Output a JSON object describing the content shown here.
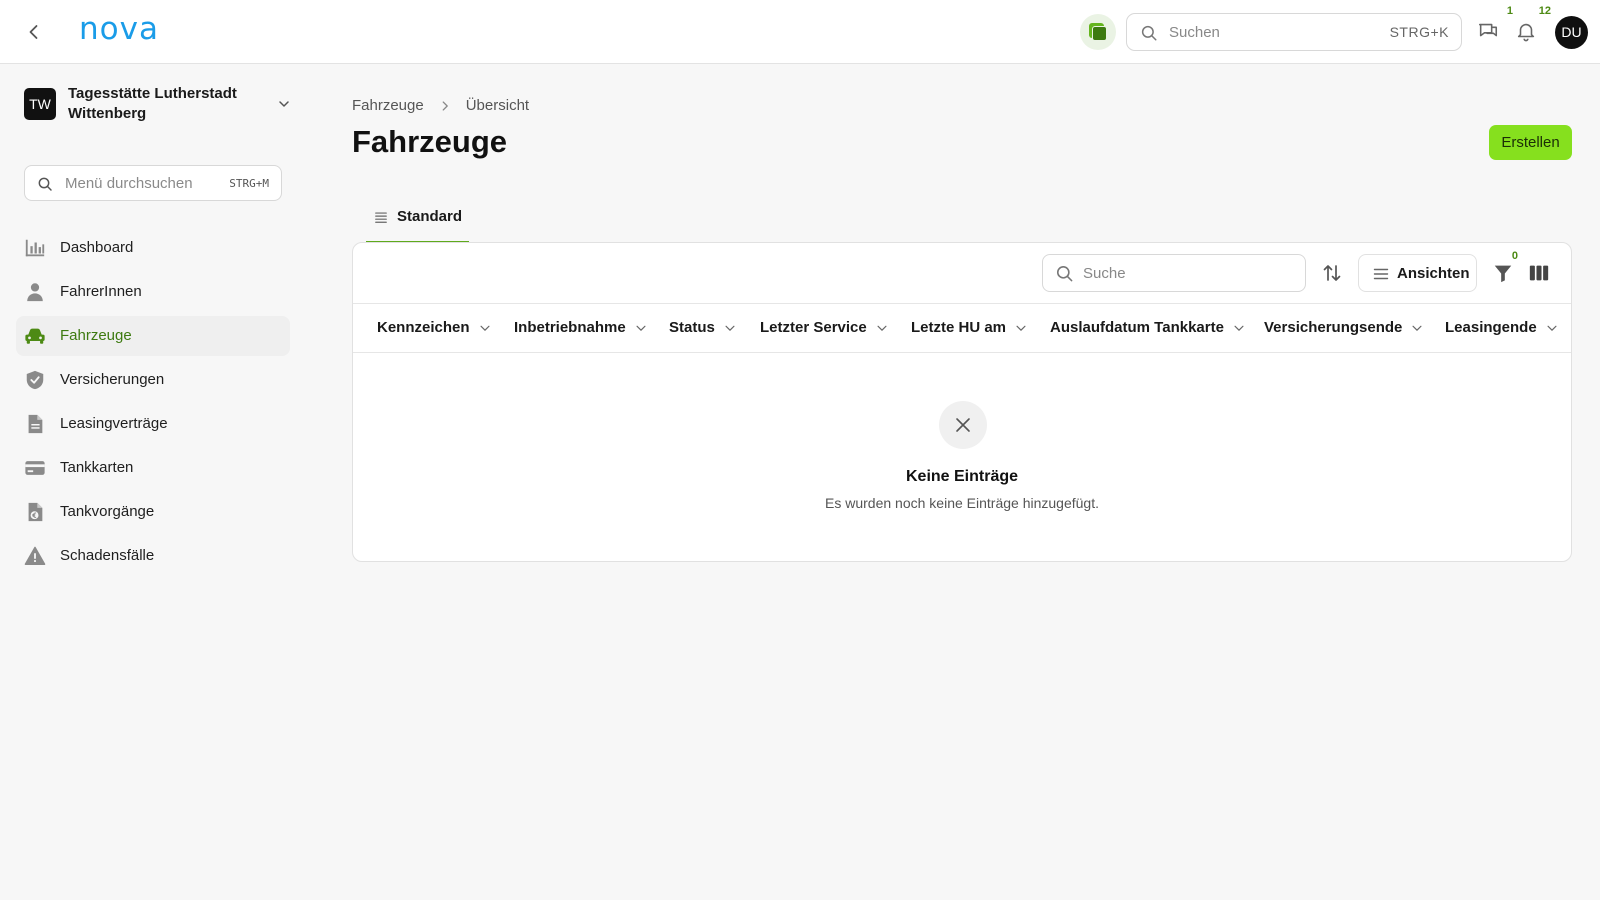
{
  "topbar": {
    "logo": "nova",
    "search_placeholder": "Suchen",
    "search_shortcut": "STRG+K",
    "messages_badge": "1",
    "notifications_badge": "12",
    "avatar_initials": "DU"
  },
  "sidebar": {
    "org_initials": "TW",
    "org_name": "Tagesstätte Lutherstadt Wittenberg",
    "menu_search_placeholder": "Menü durchsuchen",
    "menu_search_shortcut": "STRG+M",
    "items": [
      {
        "label": "Dashboard",
        "icon": "bar-chart-icon"
      },
      {
        "label": "FahrerInnen",
        "icon": "person-icon"
      },
      {
        "label": "Fahrzeuge",
        "icon": "car-icon",
        "active": true
      },
      {
        "label": "Versicherungen",
        "icon": "shield-check-icon"
      },
      {
        "label": "Leasingverträge",
        "icon": "document-icon"
      },
      {
        "label": "Tankkarten",
        "icon": "credit-card-icon"
      },
      {
        "label": "Tankvorgänge",
        "icon": "euro-document-icon"
      },
      {
        "label": "Schadensfälle",
        "icon": "warning-icon"
      }
    ]
  },
  "main": {
    "breadcrumb": [
      "Fahrzeuge",
      "Übersicht"
    ],
    "title": "Fahrzeuge",
    "create_label": "Erstellen",
    "tab_label": "Standard",
    "table_search_placeholder": "Suche",
    "views_label": "Ansichten",
    "filter_badge": "0",
    "columns": [
      "Kennzeichen",
      "Inbetriebnahme",
      "Status",
      "Letzter Service",
      "Letzte HU am",
      "Auslaufdatum Tankkarte",
      "Versicherungsende",
      "Leasingende"
    ],
    "empty_title": "Keine Einträge",
    "empty_subtitle": "Es wurden noch keine Einträge hinzugefügt."
  },
  "colors": {
    "accent": "#86e01e",
    "accent_dark": "#4d8a14",
    "logo": "#1a9ce8"
  }
}
